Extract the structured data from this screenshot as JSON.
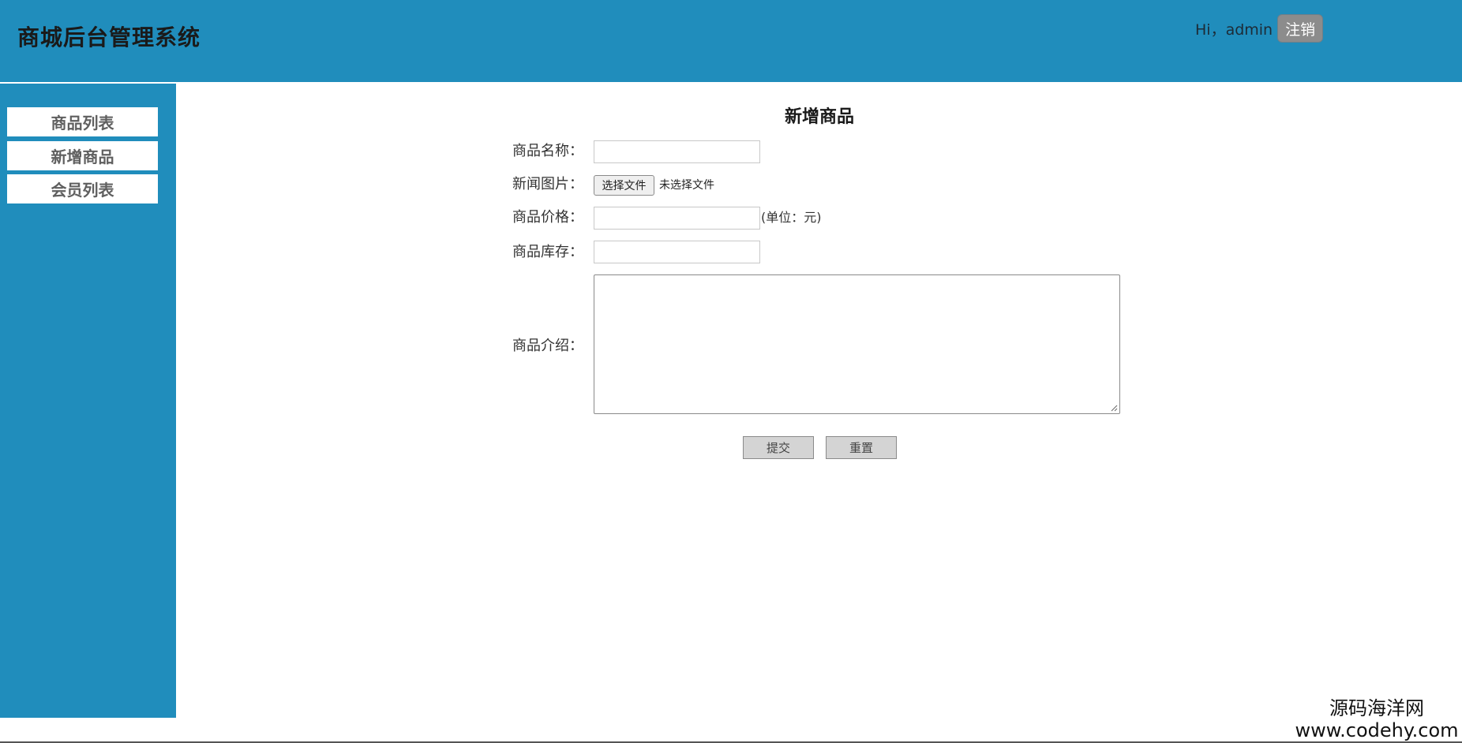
{
  "header": {
    "title": "商城后台管理系统",
    "greeting": "Hi，admin",
    "logout_label": "注销"
  },
  "sidebar": {
    "items": [
      {
        "label": "商品列表"
      },
      {
        "label": "新增商品"
      },
      {
        "label": "会员列表"
      }
    ]
  },
  "form": {
    "title": "新增商品",
    "fields": {
      "name_label": "商品名称：",
      "image_label": "新闻图片：",
      "price_label": "商品价格：",
      "stock_label": "商品库存：",
      "desc_label": "商品介绍："
    },
    "file_button_label": "选择文件",
    "file_status": "未选择文件",
    "price_unit": "(单位：元)",
    "submit_label": "提交",
    "reset_label": "重置"
  },
  "watermark": {
    "line1": "源码海洋网",
    "line2": "www.codehy.com"
  },
  "colors": {
    "header_bg": "#208dbc",
    "sidebar_bg": "#208dbc",
    "logout_bg": "#8c8c8c",
    "button_bg": "#d4d4d4"
  }
}
